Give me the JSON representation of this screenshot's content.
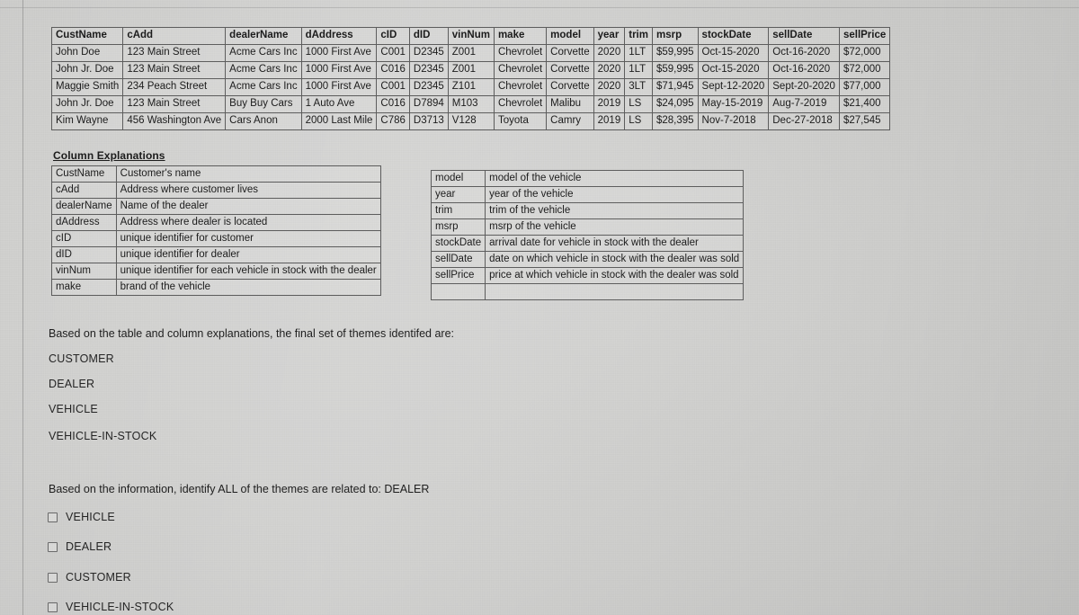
{
  "main_table": {
    "headers": [
      "CustName",
      "cAdd",
      "dealerName",
      "dAddress",
      "cID",
      "dID",
      "vinNum",
      "make",
      "model",
      "year",
      "trim",
      "msrp",
      "stockDate",
      "sellDate",
      "sellPrice"
    ],
    "rows": [
      [
        "John Doe",
        "123 Main Street",
        "Acme Cars Inc",
        "1000 First Ave",
        "C001",
        "D2345",
        "Z001",
        "Chevrolet",
        "Corvette",
        "2020",
        "1LT",
        "$59,995",
        "Oct-15-2020",
        "Oct-16-2020",
        "$72,000"
      ],
      [
        "John Jr. Doe",
        "123 Main Street",
        "Acme Cars Inc",
        "1000 First Ave",
        "C016",
        "D2345",
        "Z001",
        "Chevrolet",
        "Corvette",
        "2020",
        "1LT",
        "$59,995",
        "Oct-15-2020",
        "Oct-16-2020",
        "$72,000"
      ],
      [
        "Maggie Smith",
        "234 Peach Street",
        "Acme Cars Inc",
        "1000 First Ave",
        "C001",
        "D2345",
        "Z101",
        "Chevrolet",
        "Corvette",
        "2020",
        "3LT",
        "$71,945",
        "Sept-12-2020",
        "Sept-20-2020",
        "$77,000"
      ],
      [
        "John Jr. Doe",
        "123 Main Street",
        "Buy Buy Cars",
        "1 Auto Ave",
        "C016",
        "D7894",
        "M103",
        "Chevrolet",
        "Malibu",
        "2019",
        "LS",
        "$24,095",
        "May-15-2019",
        "Aug-7-2019",
        "$21,400"
      ],
      [
        "Kim Wayne",
        "456 Washington Ave",
        "Cars Anon",
        "2000 Last Mile",
        "C786",
        "D3713",
        "V128",
        "Toyota",
        "Camry",
        "2019",
        "LS",
        "$28,395",
        "Nov-7-2018",
        "Dec-27-2018",
        "$27,545"
      ]
    ]
  },
  "explanations": {
    "title": "Column Explanations",
    "left": [
      {
        "key": "CustName",
        "desc": "Customer's name"
      },
      {
        "key": "cAdd",
        "desc": "Address where customer lives"
      },
      {
        "key": "dealerName",
        "desc": "Name of the dealer"
      },
      {
        "key": "dAddress",
        "desc": "Address where dealer is located"
      },
      {
        "key": "cID",
        "desc": "unique identifier for customer"
      },
      {
        "key": "dID",
        "desc": "unique identifier for dealer"
      },
      {
        "key": "vinNum",
        "desc": "unique identifier for each vehicle in stock with the dealer"
      },
      {
        "key": "make",
        "desc": "brand of the vehicle"
      }
    ],
    "right": [
      {
        "key": "model",
        "desc": "model of the vehicle"
      },
      {
        "key": "year",
        "desc": "year of the vehicle"
      },
      {
        "key": "trim",
        "desc": "trim of the vehicle"
      },
      {
        "key": "msrp",
        "desc": "msrp of the vehicle"
      },
      {
        "key": "stockDate",
        "desc": "arrival date for vehicle in stock with the dealer"
      },
      {
        "key": "sellDate",
        "desc": "date on which vehicle in stock with the dealer was sold"
      },
      {
        "key": "sellPrice",
        "desc": "price at which vehicle in stock with the dealer was sold"
      },
      {
        "key": "",
        "desc": ""
      }
    ]
  },
  "themes_section": {
    "intro": "Based on the table and column explanations, the final set of themes identifed are:",
    "themes": [
      "CUSTOMER",
      "DEALER",
      "VEHICLE",
      "VEHICLE-IN-STOCK"
    ]
  },
  "question_section": {
    "prompt": "Based on the information, identify ALL of the themes are related to: DEALER",
    "options": [
      {
        "label": "VEHICLE",
        "checked": false
      },
      {
        "label": "DEALER",
        "checked": false
      },
      {
        "label": "CUSTOMER",
        "checked": false
      },
      {
        "label": "VEHICLE-IN-STOCK",
        "checked": false
      }
    ]
  },
  "colors": {
    "background": "#cdcdcb",
    "border": "#5d5d5d",
    "text": "#1c1c1c"
  }
}
